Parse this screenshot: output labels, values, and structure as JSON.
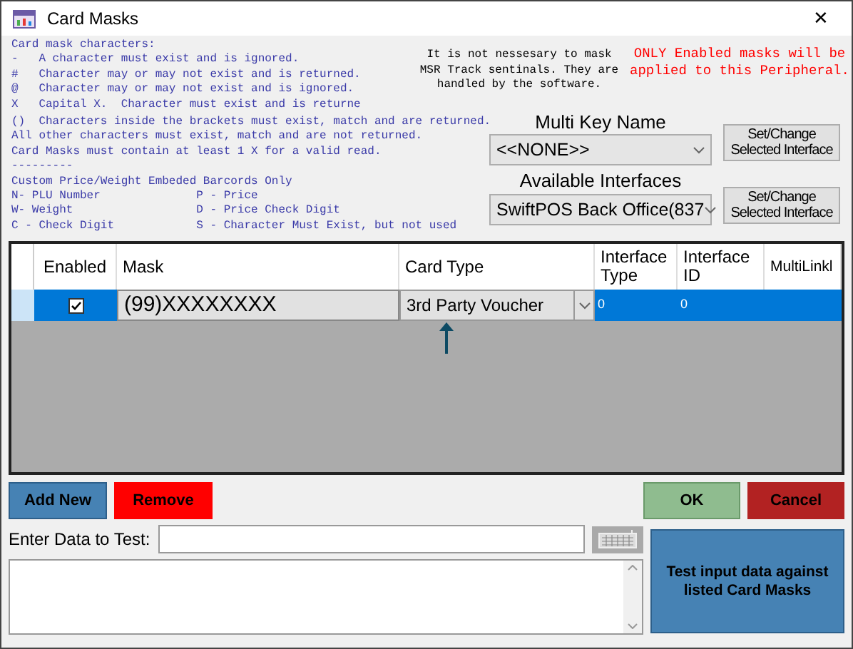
{
  "window": {
    "title": "Card Masks",
    "close": "✕"
  },
  "help_top": [
    "Card mask characters:",
    "-   A character must exist and is ignored.",
    "#   Character may or may not exist and is returned.",
    "@   Character may or may not exist and is ignored.",
    "X   Capital X.  Character must exist and is returne"
  ],
  "help_bottom": [
    "()  Characters inside the brackets must exist, match and are returned.",
    "All other characters must exist, match and are not returned.",
    "Card Masks must contain at least 1 X for a valid read.",
    "---------",
    "Custom Price/Weight Embeded Barcords Only",
    "N- PLU Number              P - Price",
    "W- Weight                  D - Price Check Digit",
    "C - Check Digit            S - Character Must Exist, but not used"
  ],
  "sentinel_note": "It is not nessesary to mask MSR Track sentinals. They are handled by the software.",
  "warning_note": "ONLY Enabled masks will be applied to this Peripheral.",
  "multi_key": {
    "label": "Multi Key Name",
    "value": "<<NONE>>",
    "button": "Set/Change Selected Interface"
  },
  "interfaces": {
    "label": "Available Interfaces",
    "value": "SwiftPOS Back Office(837",
    "button": "Set/Change Selected Interface"
  },
  "table": {
    "columns": [
      "Enabled",
      "Mask",
      "Card Type",
      "Interface Type",
      "Interface ID",
      "MultiLinkl"
    ],
    "rows": [
      {
        "selected": true,
        "enabled": true,
        "mask": "(99)XXXXXXXX",
        "card_type": "3rd Party Voucher",
        "interface_type": "0",
        "interface_id": "0"
      }
    ]
  },
  "buttons": {
    "add": "Add New",
    "remove": "Remove",
    "ok": "OK",
    "cancel": "Cancel"
  },
  "test": {
    "label": "Enter Data to Test:",
    "button": "Test input data against listed Card Masks"
  }
}
